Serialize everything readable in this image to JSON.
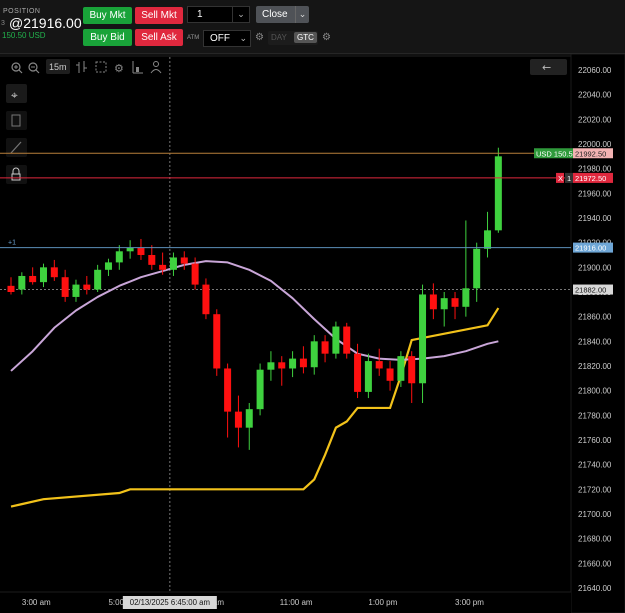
{
  "position": {
    "label": "POSITION",
    "side_marker": "3",
    "price": "@21916.00",
    "pl": "150.50 USD"
  },
  "orders": {
    "buy_mkt": "Buy Mkt",
    "sell_mkt": "Sell Mkt",
    "buy_bid": "Buy Bid",
    "sell_ask": "Sell Ask",
    "quantity": "1",
    "close": "Close",
    "atm_label": "ATM",
    "atm_value": "OFF",
    "tif_day": "DAY",
    "tif_gtc": "GTC"
  },
  "chart_toolbar": {
    "interval": "15m"
  },
  "colors": {
    "up": "#3fd13f",
    "down": "#ff1010",
    "ma": "#c9a6d8",
    "trail": "#f2c21a",
    "target_line": "#b87f3a",
    "stop_line": "#e0283e",
    "entry_line": "#5b8fb9"
  },
  "chart_data": {
    "type": "candlestick",
    "y_ticks": [
      "22060.00",
      "22040.00",
      "22020.00",
      "22000.00",
      "21980.00",
      "21960.00",
      "21940.00",
      "21920.00",
      "21900.00",
      "21880.00",
      "21860.00",
      "21840.00",
      "21820.00",
      "21800.00",
      "21780.00",
      "21760.00",
      "21740.00",
      "21720.00",
      "21700.00",
      "21680.00",
      "21660.00",
      "21640.00"
    ],
    "ylim": [
      21630,
      22070
    ],
    "x_labels": [
      {
        "t": 7,
        "label": "3:00 am"
      },
      {
        "t": 31,
        "label": "5:00 am"
      },
      {
        "t": 55,
        "label": "9:00 am"
      },
      {
        "t": 79,
        "label": "11:00 am"
      },
      {
        "t": 103,
        "label": "1:00 pm"
      },
      {
        "t": 127,
        "label": "3:00 pm"
      }
    ],
    "cursor_time": "02/13/2025 6:45:00 am",
    "cursor_t": 44,
    "cursor_price": "21882.00",
    "cursor_price_value": 21882,
    "target": {
      "price": 21992.5,
      "label": "21992.50",
      "tag": "USD 150.50"
    },
    "stop": {
      "price": 21972.5,
      "label": "21972.50",
      "tag_x": "X",
      "tag_qty": "1"
    },
    "entry": {
      "price": 21916,
      "label": "21916.00",
      "tag": "+1"
    },
    "candles": [
      {
        "t": 0,
        "o": 21885,
        "h": 21892,
        "l": 21878,
        "c": 21880
      },
      {
        "t": 3,
        "o": 21882,
        "h": 21896,
        "l": 21878,
        "c": 21893
      },
      {
        "t": 6,
        "o": 21893,
        "h": 21900,
        "l": 21886,
        "c": 21888
      },
      {
        "t": 9,
        "o": 21888,
        "h": 21903,
        "l": 21884,
        "c": 21900
      },
      {
        "t": 12,
        "o": 21900,
        "h": 21906,
        "l": 21889,
        "c": 21892
      },
      {
        "t": 15,
        "o": 21892,
        "h": 21898,
        "l": 21872,
        "c": 21876
      },
      {
        "t": 18,
        "o": 21876,
        "h": 21890,
        "l": 21872,
        "c": 21886
      },
      {
        "t": 21,
        "o": 21886,
        "h": 21893,
        "l": 21878,
        "c": 21882
      },
      {
        "t": 24,
        "o": 21882,
        "h": 21902,
        "l": 21880,
        "c": 21898
      },
      {
        "t": 27,
        "o": 21898,
        "h": 21907,
        "l": 21893,
        "c": 21904
      },
      {
        "t": 30,
        "o": 21904,
        "h": 21918,
        "l": 21898,
        "c": 21913
      },
      {
        "t": 33,
        "o": 21913,
        "h": 21922,
        "l": 21907,
        "c": 21916
      },
      {
        "t": 36,
        "o": 21916,
        "h": 21923,
        "l": 21906,
        "c": 21910
      },
      {
        "t": 39,
        "o": 21910,
        "h": 21918,
        "l": 21898,
        "c": 21902
      },
      {
        "t": 42,
        "o": 21902,
        "h": 21912,
        "l": 21894,
        "c": 21898
      },
      {
        "t": 45,
        "o": 21898,
        "h": 21912,
        "l": 21893,
        "c": 21908
      },
      {
        "t": 48,
        "o": 21908,
        "h": 21913,
        "l": 21898,
        "c": 21903
      },
      {
        "t": 51,
        "o": 21903,
        "h": 21908,
        "l": 21882,
        "c": 21886
      },
      {
        "t": 54,
        "o": 21886,
        "h": 21891,
        "l": 21858,
        "c": 21862
      },
      {
        "t": 57,
        "o": 21862,
        "h": 21866,
        "l": 21812,
        "c": 21818
      },
      {
        "t": 60,
        "o": 21818,
        "h": 21822,
        "l": 21762,
        "c": 21783
      },
      {
        "t": 63,
        "o": 21783,
        "h": 21796,
        "l": 21754,
        "c": 21770
      },
      {
        "t": 66,
        "o": 21770,
        "h": 21790,
        "l": 21752,
        "c": 21785
      },
      {
        "t": 69,
        "o": 21785,
        "h": 21822,
        "l": 21780,
        "c": 21817
      },
      {
        "t": 72,
        "o": 21817,
        "h": 21832,
        "l": 21808,
        "c": 21823
      },
      {
        "t": 75,
        "o": 21823,
        "h": 21828,
        "l": 21804,
        "c": 21818
      },
      {
        "t": 78,
        "o": 21818,
        "h": 21832,
        "l": 21811,
        "c": 21826
      },
      {
        "t": 81,
        "o": 21826,
        "h": 21836,
        "l": 21814,
        "c": 21819
      },
      {
        "t": 84,
        "o": 21819,
        "h": 21845,
        "l": 21813,
        "c": 21840
      },
      {
        "t": 87,
        "o": 21840,
        "h": 21845,
        "l": 21823,
        "c": 21830
      },
      {
        "t": 90,
        "o": 21830,
        "h": 21856,
        "l": 21826,
        "c": 21852
      },
      {
        "t": 93,
        "o": 21852,
        "h": 21855,
        "l": 21826,
        "c": 21830
      },
      {
        "t": 96,
        "o": 21830,
        "h": 21838,
        "l": 21794,
        "c": 21799
      },
      {
        "t": 99,
        "o": 21799,
        "h": 21830,
        "l": 21794,
        "c": 21824
      },
      {
        "t": 102,
        "o": 21824,
        "h": 21834,
        "l": 21812,
        "c": 21818
      },
      {
        "t": 105,
        "o": 21818,
        "h": 21824,
        "l": 21800,
        "c": 21808
      },
      {
        "t": 108,
        "o": 21808,
        "h": 21832,
        "l": 21803,
        "c": 21828
      },
      {
        "t": 111,
        "o": 21828,
        "h": 21832,
        "l": 21790,
        "c": 21806
      },
      {
        "t": 114,
        "o": 21806,
        "h": 21886,
        "l": 21790,
        "c": 21878
      },
      {
        "t": 117,
        "o": 21878,
        "h": 21887,
        "l": 21858,
        "c": 21866
      },
      {
        "t": 120,
        "o": 21866,
        "h": 21880,
        "l": 21852,
        "c": 21875
      },
      {
        "t": 123,
        "o": 21875,
        "h": 21880,
        "l": 21858,
        "c": 21868
      },
      {
        "t": 126,
        "o": 21868,
        "h": 21938,
        "l": 21860,
        "c": 21883
      },
      {
        "t": 129,
        "o": 21883,
        "h": 21920,
        "l": 21872,
        "c": 21915
      },
      {
        "t": 132,
        "o": 21915,
        "h": 21945,
        "l": 21908,
        "c": 21930
      },
      {
        "t": 135,
        "o": 21930,
        "h": 21997,
        "l": 21928,
        "c": 21990
      }
    ],
    "ma": [
      [
        0,
        21816
      ],
      [
        6,
        21832
      ],
      [
        12,
        21851
      ],
      [
        18,
        21865
      ],
      [
        24,
        21876
      ],
      [
        30,
        21885
      ],
      [
        36,
        21892
      ],
      [
        42,
        21897
      ],
      [
        48,
        21902
      ],
      [
        54,
        21905
      ],
      [
        60,
        21904
      ],
      [
        66,
        21898
      ],
      [
        72,
        21889
      ],
      [
        78,
        21875
      ],
      [
        84,
        21858
      ],
      [
        90,
        21842
      ],
      [
        96,
        21830
      ],
      [
        102,
        21826
      ],
      [
        108,
        21825
      ],
      [
        114,
        21826
      ],
      [
        120,
        21828
      ],
      [
        126,
        21832
      ],
      [
        132,
        21838
      ],
      [
        135,
        21840
      ]
    ],
    "trail": [
      [
        0,
        21706
      ],
      [
        3,
        21708
      ],
      [
        9,
        21712
      ],
      [
        30,
        21717
      ],
      [
        33,
        21720
      ],
      [
        81,
        21720
      ],
      [
        84,
        21728
      ],
      [
        87,
        21748
      ],
      [
        90,
        21770
      ],
      [
        93,
        21775
      ],
      [
        96,
        21786
      ],
      [
        105,
        21786
      ],
      [
        108,
        21812
      ],
      [
        111,
        21841
      ],
      [
        132,
        21853
      ],
      [
        135,
        21867
      ]
    ]
  }
}
